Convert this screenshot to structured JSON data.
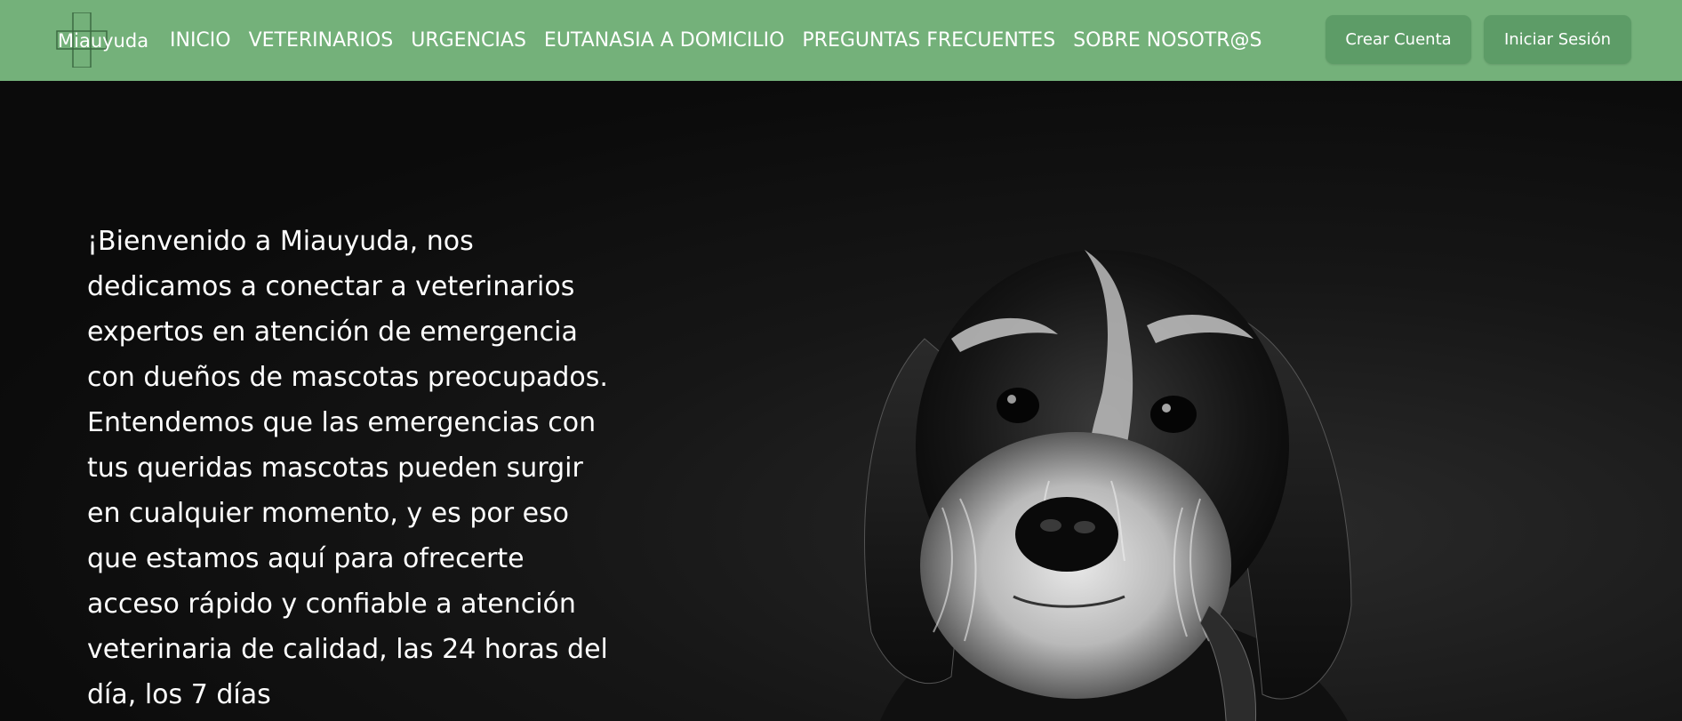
{
  "brand": {
    "name": "Miauyuda",
    "icon": "medical-cross-icon"
  },
  "nav": {
    "items": [
      {
        "label": "INICIO"
      },
      {
        "label": "VETERINARIOS"
      },
      {
        "label": "URGENCIAS"
      },
      {
        "label": "EUTANASIA A DOMICILIO"
      },
      {
        "label": "PREGUNTAS FRECUENTES"
      },
      {
        "label": "SOBRE NOSOTR@S"
      }
    ]
  },
  "auth": {
    "create_label": "Crear Cuenta",
    "login_label": "Iniciar Sesión"
  },
  "hero": {
    "text": "¡Bienvenido a Miauyuda, nos dedicamos a conectar a veterinarios expertos en atención de emergencia con dueños de mascotas preocupados. Entendemos que las emergencias con tus queridas mascotas pueden surgir en cualquier momento, y es por eso que estamos aquí para ofrecerte acceso rápido y confiable a atención veterinaria de calidad, las 24 horas del día, los 7 días",
    "image": "black-and-white-dog-photo"
  },
  "colors": {
    "navbar": "#74b17a",
    "button": "#5d9c67",
    "hero_background": "#0c0c0c",
    "text": "#ffffff"
  }
}
